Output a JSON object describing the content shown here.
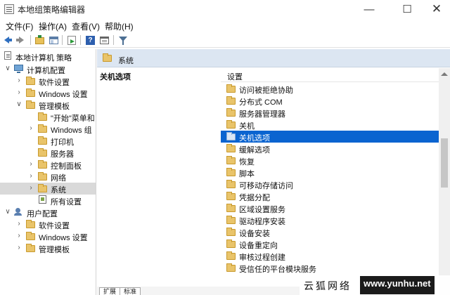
{
  "window": {
    "title": "本地组策略编辑器",
    "controls": {
      "minimize": "—",
      "maximize": "☐",
      "close": "✕"
    }
  },
  "menu": [
    "文件(F)",
    "操作(A)",
    "查看(V)",
    "帮助(H)"
  ],
  "toolbar": {
    "icons": [
      "back-icon",
      "forward-icon",
      "up-folder-icon",
      "show-hide-tree-icon",
      "export-list-icon",
      "help-icon",
      "properties-icon",
      "filter-icon"
    ],
    "help_glyph": "?"
  },
  "tree": {
    "root": "本地计算机 策略",
    "items": [
      {
        "label": "计算机配置",
        "toggle": "∨",
        "icon": "computer-icon",
        "selected": false
      },
      {
        "label": "软件设置",
        "toggle": "›",
        "icon": "folder-icon",
        "selected": false
      },
      {
        "label": "Windows 设置",
        "toggle": "›",
        "icon": "folder-icon",
        "selected": false
      },
      {
        "label": "管理模板",
        "toggle": "∨",
        "icon": "folder-icon",
        "selected": false
      },
      {
        "label": "\"开始\"菜单和",
        "toggle": "",
        "icon": "folder-icon",
        "selected": false
      },
      {
        "label": "Windows 组",
        "toggle": "›",
        "icon": "folder-icon",
        "selected": false
      },
      {
        "label": "打印机",
        "toggle": "",
        "icon": "folder-icon",
        "selected": false
      },
      {
        "label": "服务器",
        "toggle": "",
        "icon": "folder-icon",
        "selected": false
      },
      {
        "label": "控制面板",
        "toggle": "›",
        "icon": "folder-icon",
        "selected": false
      },
      {
        "label": "网络",
        "toggle": "›",
        "icon": "folder-icon",
        "selected": false
      },
      {
        "label": "系统",
        "toggle": "›",
        "icon": "folder-icon",
        "selected": true
      },
      {
        "label": "所有设置",
        "toggle": "",
        "icon": "settings-icon",
        "selected": false
      },
      {
        "label": "用户配置",
        "toggle": "∨",
        "icon": "user-icon",
        "selected": false
      },
      {
        "label": "软件设置",
        "toggle": "›",
        "icon": "folder-icon",
        "selected": false
      },
      {
        "label": "Windows 设置",
        "toggle": "›",
        "icon": "folder-icon",
        "selected": false
      },
      {
        "label": "管理模板",
        "toggle": "›",
        "icon": "folder-icon",
        "selected": false
      }
    ]
  },
  "right": {
    "path_label": "系统",
    "description_heading": "关机选项",
    "list_header": "设置",
    "items": [
      {
        "label": "访问被拒绝协助",
        "selected": false
      },
      {
        "label": "分布式 COM",
        "selected": false
      },
      {
        "label": "服务器管理器",
        "selected": false
      },
      {
        "label": "关机",
        "selected": false
      },
      {
        "label": "关机选项",
        "selected": true
      },
      {
        "label": "缓解选项",
        "selected": false
      },
      {
        "label": "恢复",
        "selected": false
      },
      {
        "label": "脚本",
        "selected": false
      },
      {
        "label": "可移动存储访问",
        "selected": false
      },
      {
        "label": "凭据分配",
        "selected": false
      },
      {
        "label": "区域设置服务",
        "selected": false
      },
      {
        "label": "驱动程序安装",
        "selected": false
      },
      {
        "label": "设备安装",
        "selected": false
      },
      {
        "label": "设备重定向",
        "selected": false
      },
      {
        "label": "审核过程创建",
        "selected": false
      },
      {
        "label": "受信任的平台模块服务",
        "selected": false
      }
    ]
  },
  "bottom_tabs": [
    "扩展",
    "标准"
  ],
  "watermark": {
    "chinese": "云狐网络",
    "url": "www.yunhu.net"
  },
  "colors": {
    "selection": "#0a64d0",
    "path_bar": "#dce6f2",
    "folder": "#e9c46a"
  }
}
